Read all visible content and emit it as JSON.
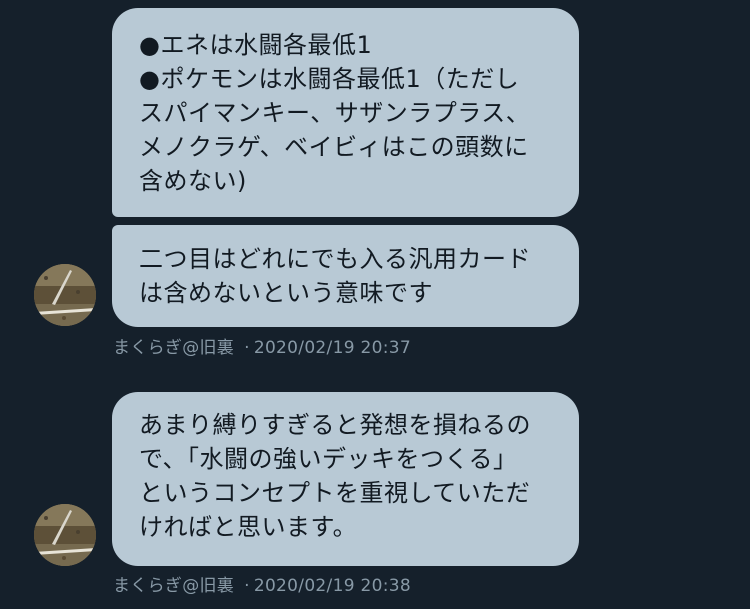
{
  "messages": [
    {
      "lines": [
        "●エネは水闘各最低1",
        "●ポケモンは水闘各最低1（ただし",
        "スパイマンキー、サザンラプラス、",
        "メノクラゲ、ベイビィはこの頭数に",
        "含めない)"
      ]
    },
    {
      "lines": [
        "二つ目はどれにでも入る汎用カード",
        "は含めないという意味です"
      ]
    },
    {
      "lines": [
        "あまり縛りすぎると発想を損ねるの",
        "で、「水闘の強いデッキをつくる」",
        "というコンセプトを重視していただ",
        "ければと思います。"
      ]
    }
  ],
  "meta": [
    {
      "author": "まくらぎ@旧裏",
      "separator": "·",
      "timestamp": "2020/02/19 20:37"
    },
    {
      "author": "まくらぎ@旧裏",
      "separator": "·",
      "timestamp": "2020/02/19 20:38"
    }
  ],
  "colors": {
    "background": "#15202b",
    "bubble": "#b8c9d5",
    "meta_text": "#8899a6"
  },
  "icons": {
    "avatar": "user-avatar-photo"
  }
}
